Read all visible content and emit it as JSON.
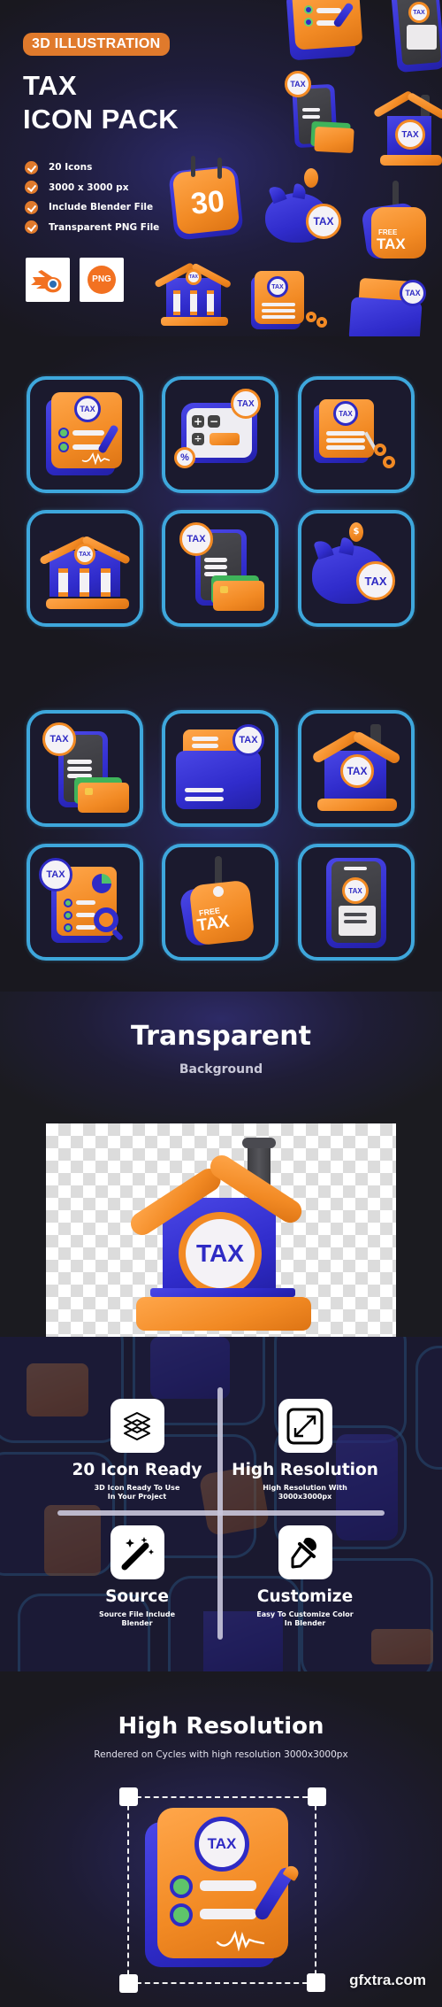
{
  "hero": {
    "badge": "3D ILLUSTRATION",
    "title_line1": "TAX",
    "title_line2": "ICON PACK",
    "features": [
      "20 Icons",
      "3000 x 3000 px",
      "Include Blender File",
      "Transparent PNG File"
    ],
    "file_types": [
      {
        "name": "Blender",
        "icon": "blender-logo-icon"
      },
      {
        "name": "PNG",
        "label": "PNG",
        "icon": "png-file-icon"
      }
    ],
    "showcase_icons": [
      "tax-document-icon",
      "tax-phone-receipt-icon",
      "tax-phone-card-icon",
      "tax-house-icon",
      "calendar-30-icon",
      "piggy-bank-tax-icon",
      "free-tax-tag-icon",
      "tax-bank-icon",
      "tax-document-cut-icon",
      "tax-folder-icon"
    ],
    "calendar_day": "30",
    "free_tag": {
      "line1": "FREE",
      "line2": "TAX"
    }
  },
  "coin_label": "TAX",
  "grid": {
    "rows": [
      [
        {
          "name": "tax-document-checklist-icon"
        },
        {
          "name": "tax-calculator-icon",
          "badge": "%"
        },
        {
          "name": "tax-document-cut-icon"
        }
      ],
      [
        {
          "name": "tax-bank-icon"
        },
        {
          "name": "tax-phone-card-icon"
        },
        {
          "name": "piggy-bank-tax-icon",
          "coin": "$"
        }
      ],
      [
        {
          "name": "tax-phone-card-icon"
        },
        {
          "name": "tax-folder-icon"
        },
        {
          "name": "tax-house-icon"
        }
      ],
      [
        {
          "name": "tax-report-search-icon"
        },
        {
          "name": "free-tax-tag-icon",
          "line1": "FREE",
          "line2": "TAX"
        },
        {
          "name": "tax-phone-receipt-icon"
        }
      ]
    ]
  },
  "transparent": {
    "title": "Transparent",
    "subtitle": "Background",
    "preview_icon": "tax-house-icon"
  },
  "features": [
    {
      "title": "20 Icon Ready",
      "desc": "3D Icon Ready To Use\nIn Your Project",
      "icon": "layers-icon"
    },
    {
      "title": "High Resolution",
      "desc": "High Resolution With\n3000x3000px",
      "icon": "resize-arrows-icon"
    },
    {
      "title": "Source",
      "desc": "Source File Include\nBlender",
      "icon": "magic-wand-icon"
    },
    {
      "title": "Customize",
      "desc": "Easy To Customize Color\nIn Blender",
      "icon": "color-picker-icon"
    }
  ],
  "high_resolution": {
    "title": "High Resolution",
    "subtitle": "Rendered on Cycles with high resolution 3000x3000px",
    "preview_icon": "tax-document-checklist-icon"
  },
  "watermark": "gfxtra.com",
  "colors": {
    "accent_orange": "#e07a2c",
    "icon_orange": "#f28a24",
    "icon_blue": "#302ccc",
    "card_border": "#3ea7dc",
    "background": "#1b1b20"
  }
}
